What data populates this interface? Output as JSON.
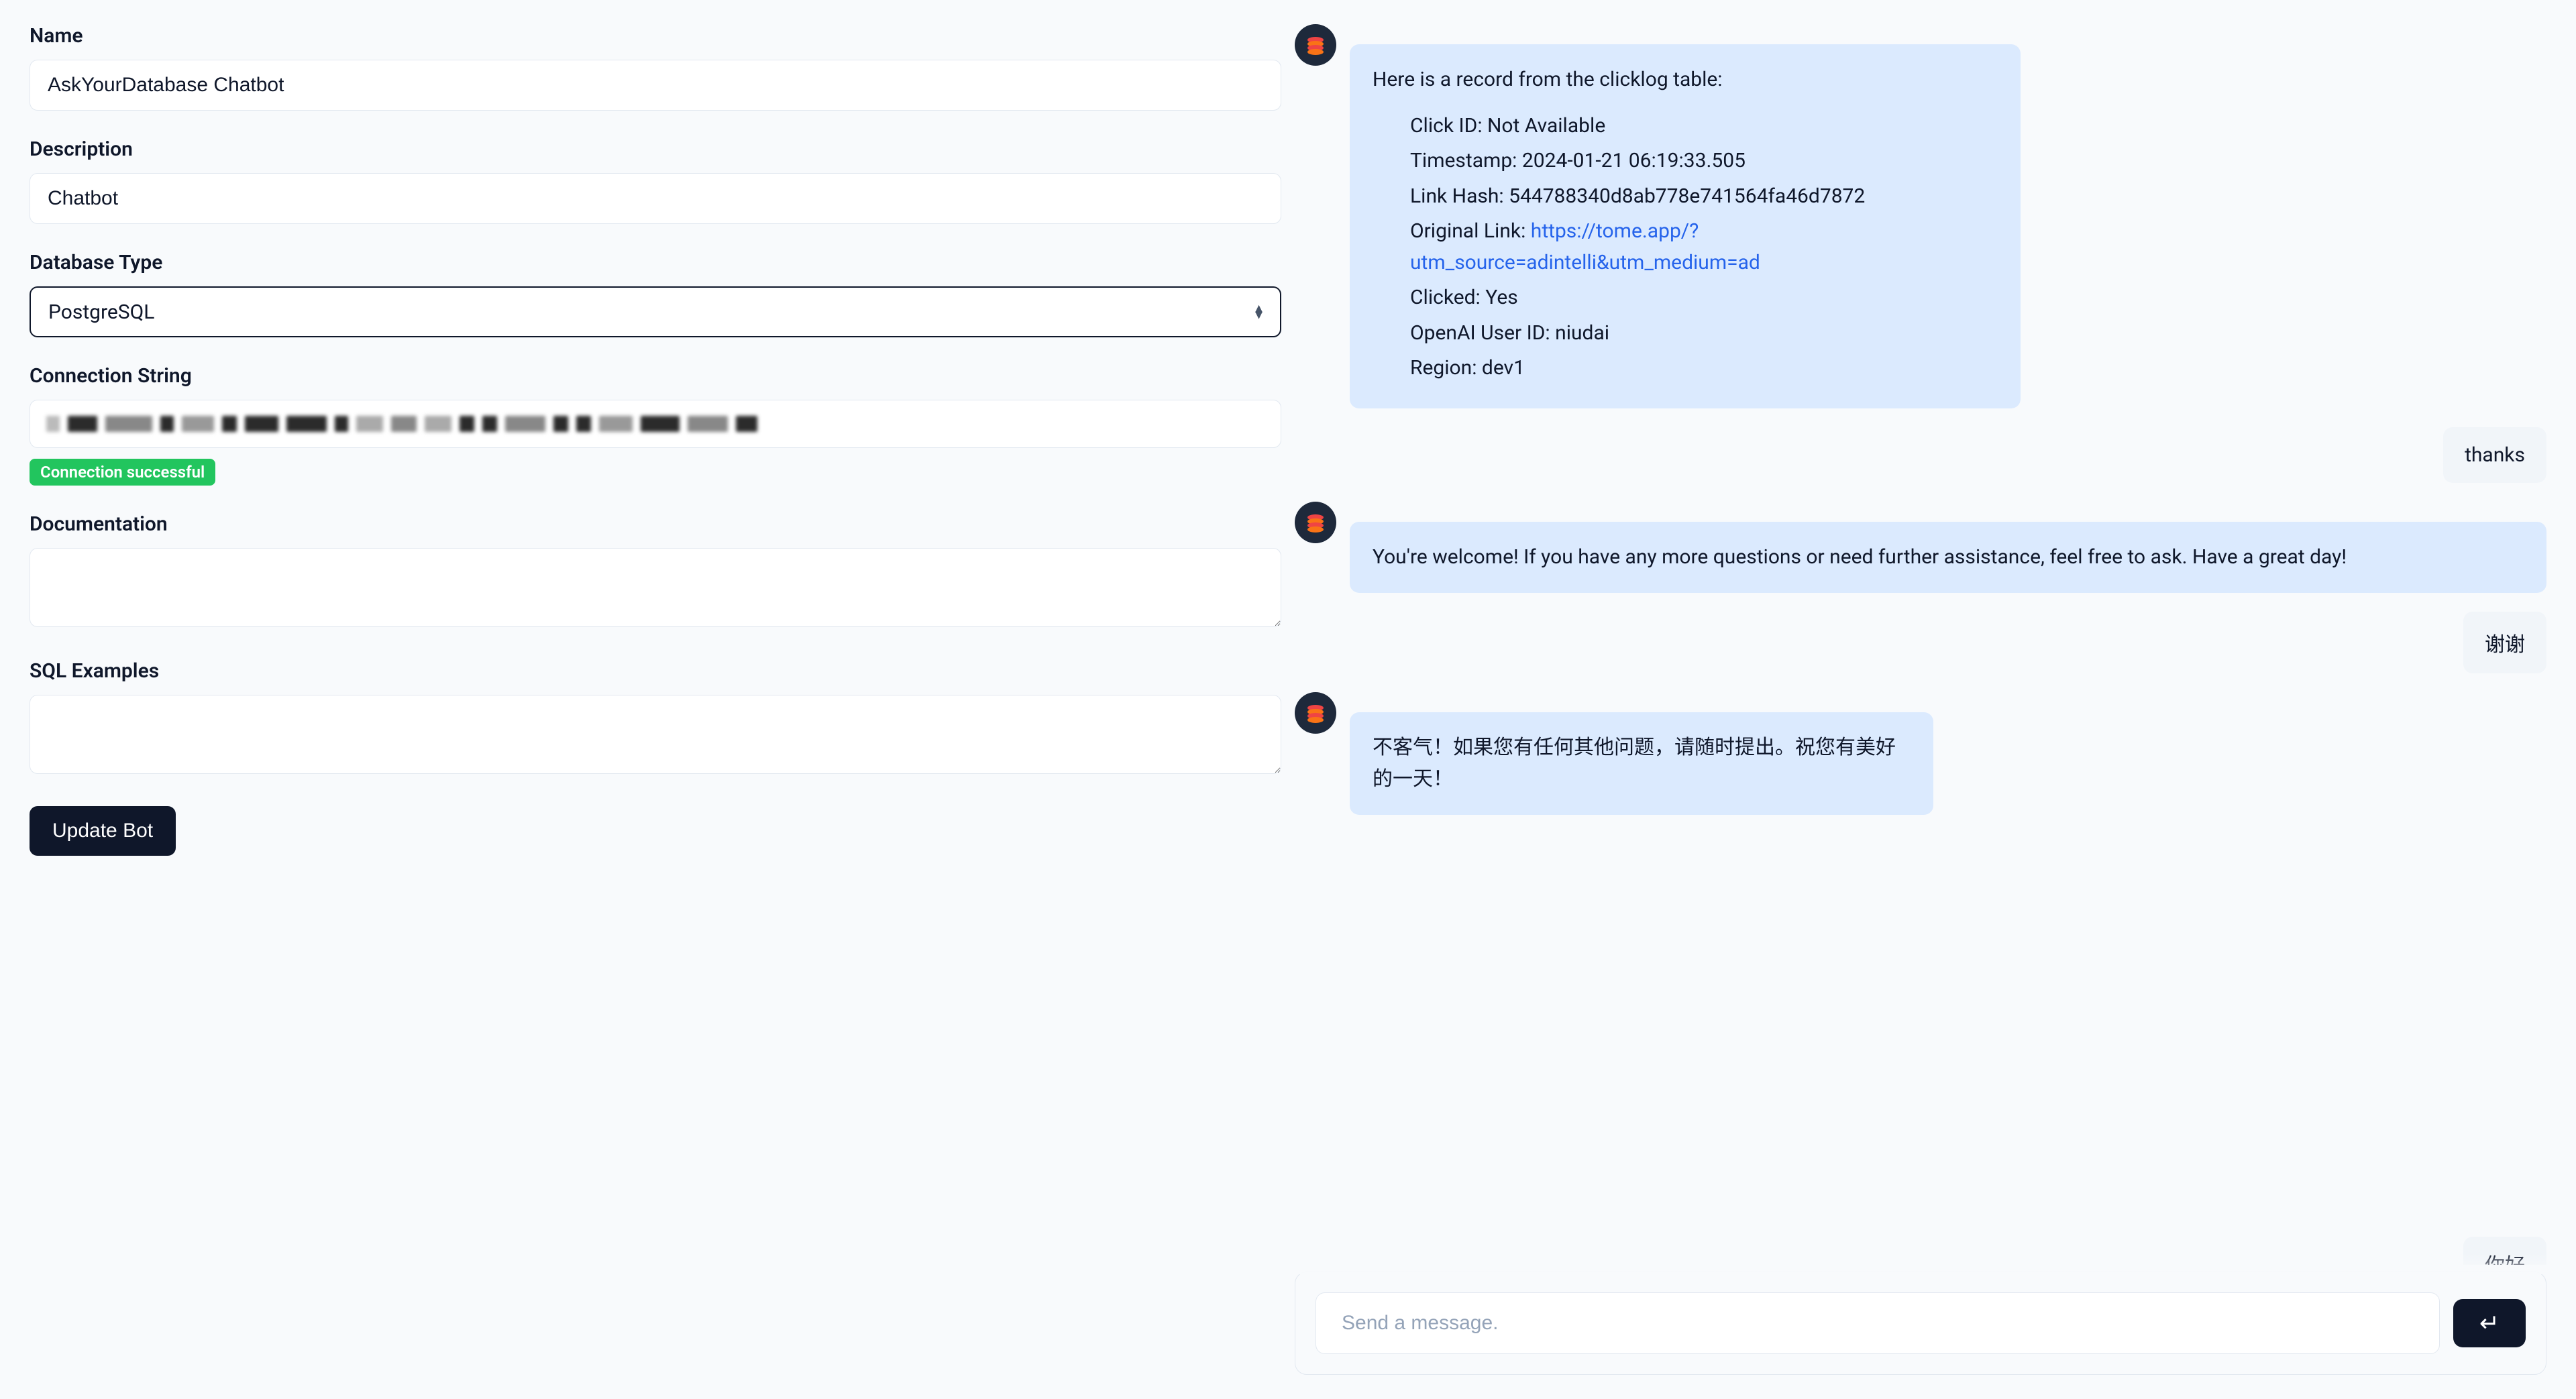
{
  "form": {
    "name_label": "Name",
    "name_value": "AskYourDatabase Chatbot",
    "description_label": "Description",
    "description_value": "Chatbot",
    "dbtype_label": "Database Type",
    "dbtype_value": "PostgreSQL",
    "connstr_label": "Connection String",
    "connstr_status": "Connection successful",
    "documentation_label": "Documentation",
    "documentation_value": "",
    "sql_examples_label": "SQL Examples",
    "sql_examples_value": "",
    "submit_label": "Update Bot"
  },
  "chat": {
    "bot1": {
      "intro": "Here is a record from the clicklog table:",
      "click_id_label": "Click ID: ",
      "click_id_value": "Not Available",
      "timestamp_label": "Timestamp: ",
      "timestamp_value": "2024-01-21 06:19:33.505",
      "linkhash_label": "Link Hash: ",
      "linkhash_value": "544788340d8ab778e741564fa46d7872",
      "origlink_label": "Original Link: ",
      "origlink_value": "https://tome.app/?utm_source=adintelli&utm_medium=ad",
      "clicked_label": "Clicked: ",
      "clicked_value": "Yes",
      "openai_label": "OpenAI User ID: ",
      "openai_value": "niudai",
      "region_label": "Region: ",
      "region_value": "dev1"
    },
    "user1": "thanks",
    "bot2": "You're welcome! If you have any more questions or need further assistance, feel free to ask. Have a great day!",
    "user2": "谢谢",
    "bot3": "不客气！如果您有任何其他问题，请随时提出。祝您有美好的一天！",
    "user3_partial": "你好",
    "input_placeholder": "Send a message.",
    "send_icon": "↵"
  }
}
